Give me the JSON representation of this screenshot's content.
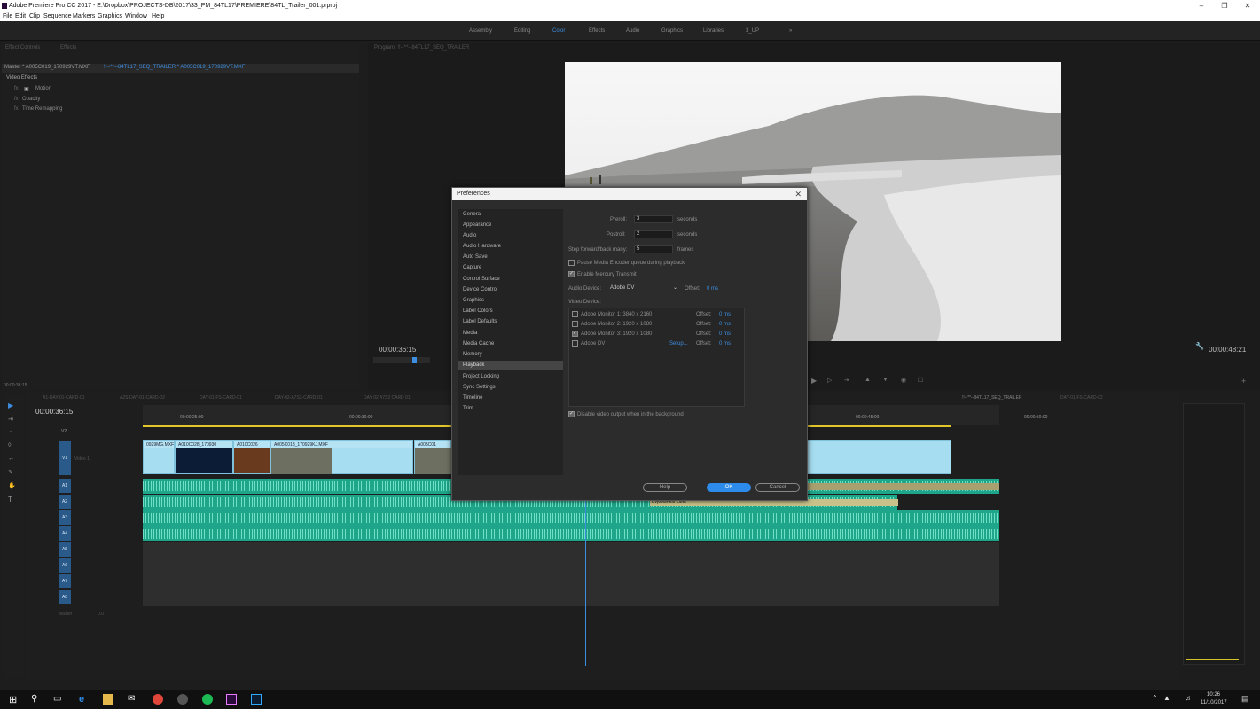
{
  "window": {
    "title": "Adobe Premiere Pro CC 2017 - E:\\Dropbox\\PROJECTS-DB\\2017\\33_PM_84TL17\\PREMIERE\\84TL_Trailer_001.prproj"
  },
  "menu": [
    "File",
    "Edit",
    "Clip",
    "Sequence",
    "Markers",
    "Graphics",
    "Window",
    "Help"
  ],
  "workspaces": {
    "items": [
      "Assembly",
      "Editing",
      "Color",
      "Effects",
      "Audio",
      "Graphics",
      "Libraries",
      "3_UP"
    ],
    "active": "Color"
  },
  "effect_controls": {
    "tabs": [
      "Effect Controls",
      "Effects"
    ],
    "master_label": "Master * A005C019_170929VT.MXF",
    "sequence_label": "!!--**--84TL17_SEQ_TRAILER * A005C019_170929VT.MXF",
    "section": "Video Effects",
    "effects": [
      "Motion",
      "Opacity",
      "Time Remapping"
    ],
    "fx": "fx",
    "timecode": "00:00:36:15"
  },
  "program_monitor": {
    "tab": "Program: !!--**--84TL17_SEQ_TRAILER",
    "timecode_left": "00:00:36:15",
    "timecode_right": "00:00:48:21"
  },
  "timeline": {
    "timecode": "00:00:36:15",
    "sequence_tabs": [
      "A1-DAY-01-CARD-01",
      "A2S-DAY-01-CARD-02",
      "DAY-01-FS-CARD-01",
      "DAY-02-A7S3-CARD-01",
      "DAY 02 A7S2 CARD 01",
      "!!--**--84TL17_SEQ_TRAILER",
      "DAY-01-FS-CARD-02"
    ],
    "ruler": [
      "00:00:25:00",
      "00:00:30:00",
      "00:00:45:00",
      "00:00:50:00"
    ],
    "video_tracks": [
      "V2",
      "V1"
    ],
    "v1_name": "Video 1",
    "audio_tracks": [
      "A1",
      "A2",
      "A3",
      "A4",
      "A5",
      "A6",
      "A7",
      "A8"
    ],
    "master": "Master",
    "master_val": "0.0",
    "clips": [
      "0929MG.MXF",
      "A010C028_170930",
      "A010C026",
      "A005C018_170929KJ.MXF",
      "A005C01"
    ],
    "transition_label": "Exponential Fade"
  },
  "dialog": {
    "title": "Preferences",
    "categories": [
      "General",
      "Appearance",
      "Audio",
      "Audio Hardware",
      "Auto Save",
      "Capture",
      "Control Surface",
      "Device Control",
      "Graphics",
      "Label Colors",
      "Label Defaults",
      "Media",
      "Media Cache",
      "Memory",
      "Playback",
      "Project Locking",
      "Sync Settings",
      "Timeline",
      "Trim"
    ],
    "selected_category": "Playback",
    "preroll": {
      "label": "Preroll:",
      "value": "3",
      "unit": "seconds"
    },
    "postroll": {
      "label": "Postroll:",
      "value": "2",
      "unit": "seconds"
    },
    "step": {
      "label": "Step forward/back many:",
      "value": "5",
      "unit": "frames"
    },
    "pause_encoder": {
      "label": "Pause Media Encoder queue during playback",
      "checked": false
    },
    "mercury_transmit": {
      "label": "Enable Mercury Transmit",
      "checked": true
    },
    "audio_device": {
      "label": "Audio Device:",
      "value": "Adobe DV",
      "offset_label": "Offset:",
      "offset_value": "0 ms"
    },
    "video_device_label": "Video Device:",
    "video_devices": [
      {
        "name": "Adobe Monitor 1: 3840 x 2160",
        "checked": false,
        "offset": "0 ms",
        "setup": ""
      },
      {
        "name": "Adobe Monitor 2: 1920 x 1080",
        "checked": false,
        "offset": "0 ms",
        "setup": ""
      },
      {
        "name": "Adobe Monitor 3: 1920 x 1080",
        "checked": true,
        "offset": "0 ms",
        "setup": ""
      },
      {
        "name": "Adobe DV",
        "checked": false,
        "offset": "0 ms",
        "setup": "Setup..."
      }
    ],
    "offset_label": "Offset:",
    "disable_video_bg": {
      "label": "Disable video output when in the background",
      "checked": true
    },
    "buttons": {
      "help": "Help",
      "ok": "OK",
      "cancel": "Cancel"
    }
  },
  "taskbar": {
    "time": "10:26",
    "date": "11/10/2017"
  },
  "colors": {
    "accent": "#2d8ceb",
    "audio_clip": "#1fa68a",
    "video_clip": "#a7ddf0",
    "track_label": "#2a5a8a"
  }
}
